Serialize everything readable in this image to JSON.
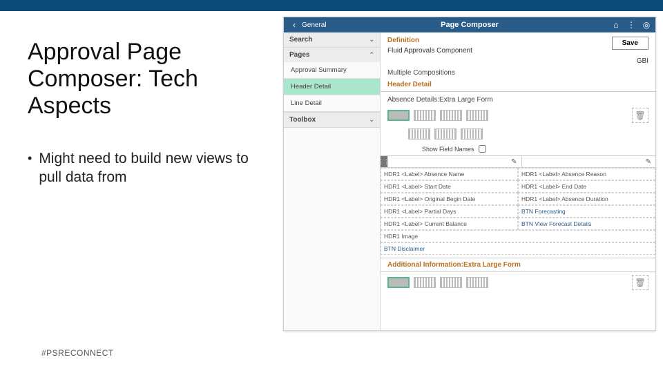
{
  "slide": {
    "title": "Approval Page Composer: Tech Aspects",
    "bullet1": "Might need to build new views to pull data from",
    "footer": "#PSRECONNECT"
  },
  "app": {
    "header": {
      "back_label": "General",
      "title": "Page Composer",
      "icons": {
        "home": "home-icon",
        "more": "more-icon",
        "help": "help-icon"
      }
    },
    "sidebar": {
      "search_label": "Search",
      "pages_label": "Pages",
      "pages": [
        {
          "label": "Approval Summary",
          "selected": false
        },
        {
          "label": "Header Detail",
          "selected": true
        },
        {
          "label": "Line Detail",
          "selected": false
        }
      ],
      "toolbox_label": "Toolbox"
    },
    "main": {
      "save_label": "Save",
      "definition_label": "Definition",
      "definition_value": "Fluid Approvals Component",
      "gbi": "GBI",
      "mult_comp": "Multiple Compositions",
      "section1_title": "Header Detail",
      "section1_form": "Absence Details:Extra Large Form",
      "trash_icon": "trash-icon",
      "show_field_label": "Show Field Names",
      "pencil_icon": "edit-icon",
      "grid": [
        [
          "HDR1 <Label> Absence Name",
          "HDR1 <Label> Absence Reason"
        ],
        [
          "HDR1 <Label> Start Date",
          "HDR1 <Label> End Date"
        ],
        [
          "HDR1 <Label> Original Begin Date",
          "HDR1 <Label> Absence Duration"
        ],
        [
          "HDR1 <Label> Partial Days",
          "BTN Forecasting"
        ],
        [
          "HDR1 <Label> Current Balance",
          "BTN View Forecast Details"
        ],
        [
          "HDR1 Image",
          ""
        ],
        [
          "BTN Disclaimer",
          ""
        ]
      ],
      "section2_title": "Additional Information:Extra Large Form"
    }
  }
}
